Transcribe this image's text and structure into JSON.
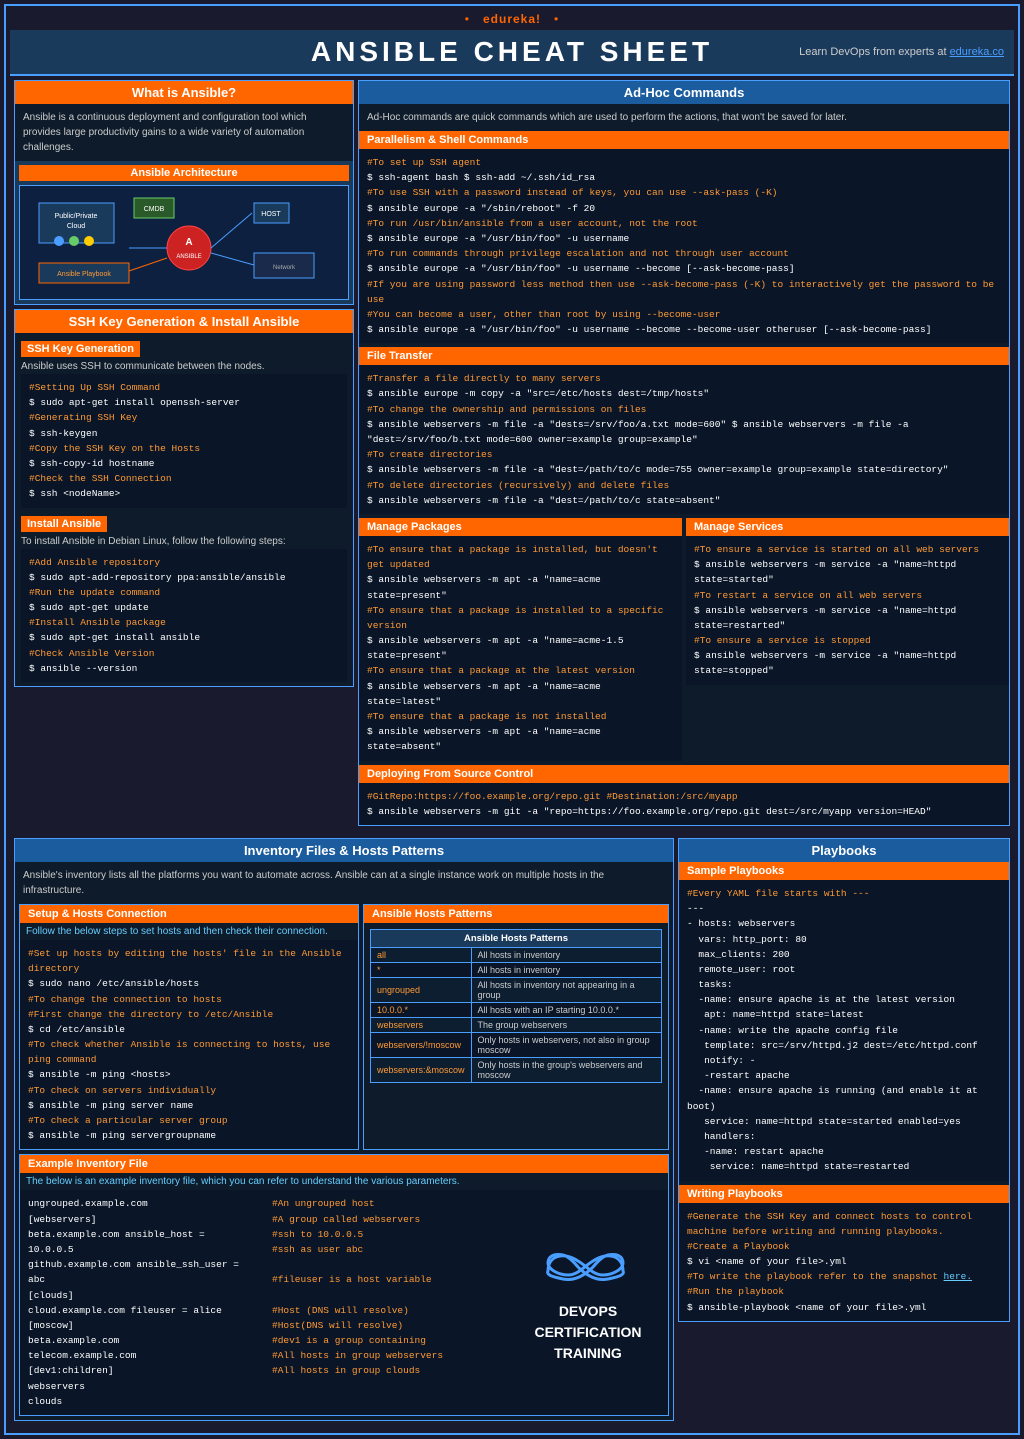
{
  "topbar": {
    "bullet_left": "•",
    "brand": "edureka!",
    "bullet_right": "•"
  },
  "header": {
    "title": "ANSIBLE CHEAT  SHEET",
    "learn_devops": "Learn DevOps from experts at",
    "learn_link": "edureka.co"
  },
  "what_is_ansible": {
    "title": "What is Ansible?",
    "description": "Ansible is a continuous  deployment and configuration tool which provides large  productivity gains to a wide variety of automation  challenges.",
    "arch_title": "Ansible Architecture"
  },
  "adhoc": {
    "title": "Ad-Hoc Commands",
    "description": "Ad-Hoc commands are quick commands which are used to perform the actions, that won't be saved for later."
  },
  "parallelism": {
    "title": "Parallelism & Shell Commands",
    "lines": [
      "#To set up SSH agent",
      "$ ssh-agent bash $ ssh-add ~/.ssh/id_rsa",
      "#To use SSH with a password instead of keys, you can use --ask-pass (-K)",
      "$ ansible europe -a \"/sbin/reboot\" -f 20",
      "#To run /usr/bin/ansible from a user account, not the root",
      "$ ansible europe -a \"/usr/bin/foo\" -u username",
      "#To run commands through privilege escalation and not through user account",
      "$ ansible europe -a \"/usr/bin/foo\" -u username --become [--ask-become-pass]",
      "#If you are using password less method then use  --ask-become-pass (-K) to interactively get the  password to be  use",
      "#You can become a user, other than root by using --become-user",
      "$ ansible europe -a \"/usr/bin/foo\" -u username --become --become-user otheruser [--ask-become-pass]"
    ]
  },
  "file_transfer": {
    "title": "File Transfer",
    "lines": [
      "#Transfer a file directly to many servers",
      "$ ansible europe -m copy -a \"src=/etc/hosts dest=/tmp/hosts\"",
      "#To change the ownership and permissions on files",
      "$ ansible webservers -m file -a \"dests=/srv/foo/a.txt mode=600\" $ ansible webservers -m file -a \"dest=/srv/foo/b.txt mode=600 owner=example group=example\"",
      "#To create directories",
      "$ ansible webservers -m file -a \"dest=/path/to/c mode=755 owner=example group=example state=directory\"",
      "#To delete directories (recursively) and delete files",
      "$ ansible webservers -m file -a \"dest=/path/to/c state=absent\""
    ]
  },
  "manage_packages": {
    "title": "Manage Packages",
    "lines": [
      "#To ensure that a package is installed, but doesn't get updated",
      "$ ansible webservers -m apt -a \"name=acme state=present\"",
      "#To ensure that a package is installed to a specific version",
      "$ ansible webservers -m apt -a \"name=acme-1.5 state=present\"",
      "#To ensure that a package at the latest version",
      "$ ansible webservers -m apt -a \"name=acme state=latest\"",
      "#To ensure that a package is not installed",
      "$ ansible webservers -m apt -a \"name=acme state=absent\""
    ]
  },
  "manage_services": {
    "title": "Manage Services",
    "lines": [
      "#To ensure a service is started on all web servers",
      "$ ansible webservers -m service -a \"name=httpd state=started\"",
      "#To restart a service on all web servers",
      "$ ansible webservers -m service -a \"name=httpd state=restarted\"",
      "#To ensure a service is stopped",
      "$ ansible webservers -m service -a \"name=httpd state=stopped\""
    ]
  },
  "deploying": {
    "title": "Deploying From Source Control",
    "line1": "#GitRepo:https://foo.example.org/repo.git                #Destination:/src/myapp",
    "line2": "$ ansible webservers -m git -a \"repo=https://foo.example.org/repo.git dest=/src/myapp version=HEAD\""
  },
  "ssh_key": {
    "title": "SSH Key Generation & Install Ansible",
    "ssh_gen_title": "SSH Key Generation",
    "ssh_desc": "Ansible uses SSH to communicate between the nodes.",
    "ssh_lines": [
      "#Setting Up SSH Command",
      "$ sudo apt-get install openssh-server",
      "#Generating SSH Key",
      "$ ssh-keygen",
      "#Copy the SSH Key on the Hosts",
      "$ ssh-copy-id hostname",
      "#Check the SSH Connection",
      "$ ssh <nodeName>"
    ],
    "install_title": "Install Ansible",
    "install_desc": "To install Ansible in Debian Linux, follow the following steps:",
    "install_lines": [
      "#Add Ansible repository",
      "$ sudo apt-add-repository ppa:ansible/ansible",
      "#Run the update command",
      "$ sudo apt-get update",
      "#Install Ansible package",
      "$ sudo apt-get install ansible",
      "#Check Ansible Version",
      "$ ansible --version"
    ]
  },
  "inventory": {
    "title": "Inventory Files & Hosts Patterns",
    "description": "Ansible's inventory lists all the platforms you want to automate across. Ansible can at a single instance work on multiple hosts in the infrastructure.",
    "setup_title": "Setup & Hosts Connection",
    "setup_desc": "Follow the below steps to set hosts and then check their connection.",
    "setup_lines": [
      "#Set up hosts by editing the hosts' file in the Ansible directory",
      "$ sudo nano /etc/ansible/hosts",
      "#To change the connection to hosts",
      "#First change the directory to /etc/Ansible",
      "$ cd /etc/ansible",
      "#To check whether Ansible is connecting to hosts, use ping command",
      "$  ansible -m ping <hosts>",
      "#To check on servers individually",
      "$ ansible -m ping server name",
      "#To check a particular server group",
      "$ ansible -m ping servergroupname"
    ],
    "hosts_patterns_title": "Ansible Hosts Patterns",
    "table_headers": [
      "Ansible  Hosts  Patterns",
      ""
    ],
    "table_rows": [
      {
        "pattern": "all",
        "desc": "All hosts in inventory"
      },
      {
        "pattern": "*",
        "desc": "All hosts in inventory"
      },
      {
        "pattern": "ungrouped",
        "desc": "All hosts in inventory  not appearing  in a group"
      },
      {
        "pattern": "10.0.0.*",
        "desc": "All hosts with an IP starting 10.0.0.*"
      },
      {
        "pattern": "webservers",
        "desc": "The group webservers"
      },
      {
        "pattern": "webservers/!moscow",
        "desc": "Only hosts in webservers,  not also in group moscow"
      },
      {
        "pattern": "webservers:&moscow",
        "desc": "Only hosts in the group's webservers  and moscow"
      }
    ],
    "example_title": "Example Inventory File",
    "example_desc": "The below is an example inventory file, which you can refer to understand the various parameters.",
    "example_lines_left": [
      "ungrouped.example.com",
      "[webservers]",
      "beta.example.com ansible_host = 10.0.0.5",
      "github.example.com ansible_ssh_user = abc",
      "[clouds]",
      "cloud.example.com fileuser = alice",
      "[moscow]",
      "beta.example.com",
      "telecom.example.com",
      "[dev1:children]",
      "webservers",
      "clouds"
    ],
    "example_lines_right": [
      "#An ungrouped host",
      "#A group called webservers",
      "#ssh to 10.0.0.5",
      "#ssh as user abc",
      "",
      "#fileuser is a host variable",
      "",
      "#Host (DNS will resolve)",
      "#Host(DNS will resolve)",
      "#dev1 is a group containing",
      "#All hosts in group webservers",
      "#All hosts in group clouds"
    ]
  },
  "playbooks": {
    "title": "Playbooks",
    "sample_title": "Sample Playbooks",
    "sample_lines": [
      "#Every YAML file starts with ---",
      "---",
      "- hosts: webservers",
      "  vars: http_port: 80",
      "  max_clients: 200",
      "  remote_user: root",
      "  tasks:",
      "  -name: ensure apache is at the latest version",
      "   apt: name=httpd state=latest",
      "  -name: write the apache config file",
      "   template: src=/srv/httpd.j2 dest=/etc/httpd.conf",
      "   notify: -",
      "   -restart apache",
      "  -name: ensure apache is running (and enable it at boot)",
      "   service: name=httpd state=started enabled=yes",
      "   handlers:",
      "   -name: restart apache",
      "    service: name=httpd state=restarted"
    ],
    "writing_title": "Writing Playbooks",
    "writing_lines": [
      "#Generate the SSH Key and connect hosts to control machine before writing and running playbooks.",
      "#Create a Playbook",
      "$ vi <name of your file>.yml",
      "#To write the playbook refer to the snapshot here.",
      "#Run the playbook",
      "$ ansible-playbook <name of your file>.yml"
    ]
  },
  "devops_cert": {
    "line1": "DEVOPS",
    "line2": "CERTIFICATION",
    "line3": "TRAINING"
  }
}
